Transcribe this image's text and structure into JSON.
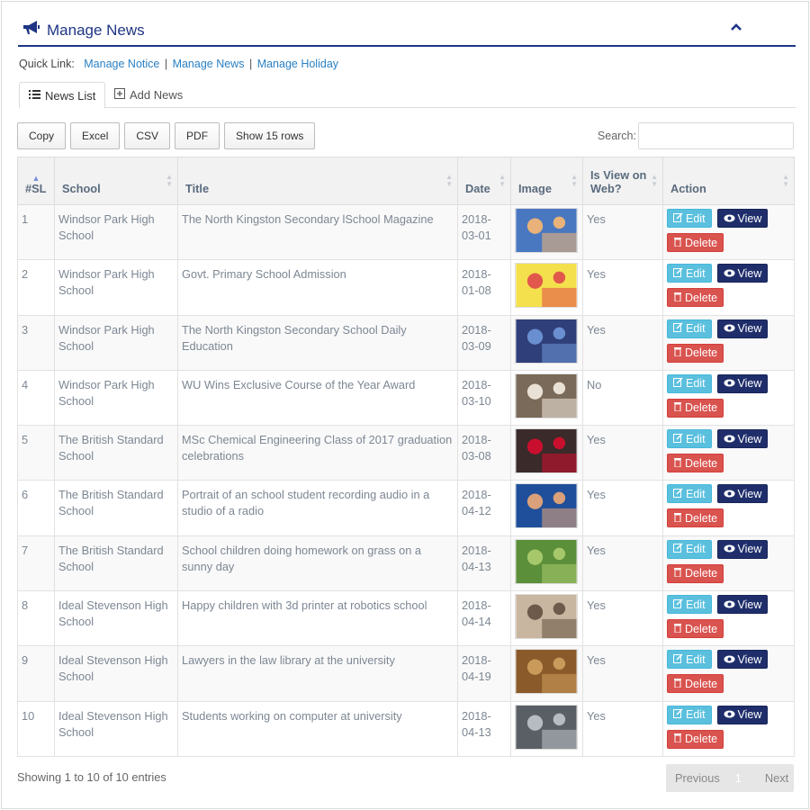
{
  "header": {
    "title": "Manage News"
  },
  "quicklinks": {
    "label": "Quick Link:",
    "links": [
      "Manage Notice",
      "Manage News",
      "Manage Holiday"
    ],
    "separator": "|"
  },
  "tabs": [
    {
      "label": "News List",
      "active": true
    },
    {
      "label": "Add News",
      "active": false
    }
  ],
  "toolbar": {
    "buttons": [
      "Copy",
      "Excel",
      "CSV",
      "PDF",
      "Show 15 rows"
    ],
    "search_label": "Search:",
    "search_value": ""
  },
  "table": {
    "columns": [
      "#SL",
      "School",
      "Title",
      "Date",
      "Image",
      "Is View on Web?",
      "Action"
    ],
    "action_labels": {
      "edit": "Edit",
      "view": "View",
      "delete": "Delete"
    },
    "rows": [
      {
        "sl": "1",
        "school": "Windsor Park High School",
        "title": "The North Kingston Secondary lSchool Magazine",
        "date": "2018-03-01",
        "view": "Yes",
        "img": [
          "#4a78c0",
          "#e8b27a"
        ]
      },
      {
        "sl": "2",
        "school": "Windsor Park High School",
        "title": "Govt. Primary School Admission",
        "date": "2018-01-08",
        "view": "Yes",
        "img": [
          "#f4e04d",
          "#e2574c"
        ]
      },
      {
        "sl": "3",
        "school": "Windsor Park High School",
        "title": "The North Kingston Secondary School Daily Education",
        "date": "2018-03-09",
        "view": "Yes",
        "img": [
          "#2f3f7a",
          "#6a8fd1"
        ]
      },
      {
        "sl": "4",
        "school": "Windsor Park High School",
        "title": "WU Wins Exclusive Course of the Year Award",
        "date": "2018-03-10",
        "view": "No",
        "img": [
          "#7a6a5a",
          "#e9e1d5"
        ]
      },
      {
        "sl": "5",
        "school": "The British Standard School",
        "title": "MSc Chemical Engineering Class of 2017 graduation celebrations",
        "date": "2018-03-08",
        "view": "Yes",
        "img": [
          "#3a2a2a",
          "#c8102e"
        ]
      },
      {
        "sl": "6",
        "school": "The British Standard School",
        "title": "Portrait of an school student recording audio in a studio of a radio",
        "date": "2018-04-12",
        "view": "Yes",
        "img": [
          "#1f4f9a",
          "#d9a07a"
        ]
      },
      {
        "sl": "7",
        "school": "The British Standard School",
        "title": "School children doing homework on grass on a sunny day",
        "date": "2018-04-13",
        "view": "Yes",
        "img": [
          "#5b8f3a",
          "#a6c86b"
        ]
      },
      {
        "sl": "8",
        "school": "Ideal Stevenson High School",
        "title": "Happy children with 3d printer at robotics school",
        "date": "2018-04-14",
        "view": "Yes",
        "img": [
          "#c9b6a0",
          "#6d5a4a"
        ]
      },
      {
        "sl": "9",
        "school": "Ideal Stevenson High School",
        "title": "Lawyers in the law library at the university",
        "date": "2018-04-19",
        "view": "Yes",
        "img": [
          "#8a5a2a",
          "#c99a5a"
        ]
      },
      {
        "sl": "10",
        "school": "Ideal Stevenson High School",
        "title": "Students working on computer at university",
        "date": "2018-04-13",
        "view": "Yes",
        "img": [
          "#5a5f66",
          "#b7bcc2"
        ]
      }
    ]
  },
  "footer": {
    "info": "Showing 1 to 10 of 10 entries",
    "prev": "Previous",
    "page": "1",
    "next": "Next"
  }
}
